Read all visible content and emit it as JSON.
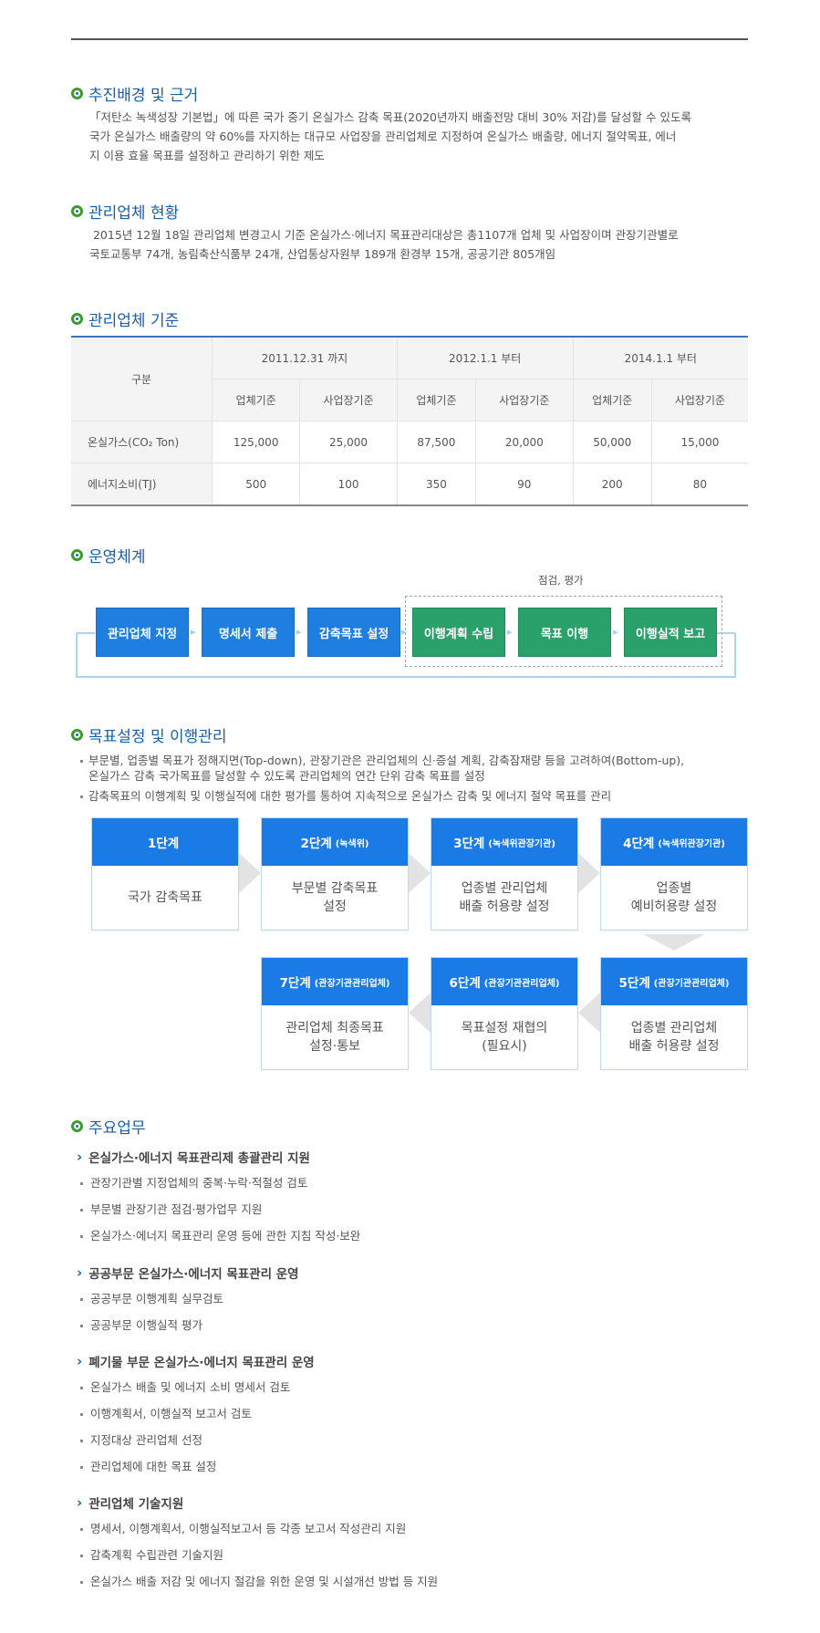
{
  "sections": {
    "background": {
      "title": "추진배경 및 근거",
      "lines": [
        "「저탄소 녹색성장 기본법」에 따른 국가 중기 온실가스 감축 목표(2020년까지 배출전망 대비 30% 저감)를 달성할 수 있도록",
        "국가 온실가스 배출량의 약 60%를 자지하는 대규모 사업장을 관리업체로 지정하여 온실가스 배출량, 에너지 절약목표, 에너",
        "지 이용 효율 목표를 설정하고 관리하기 위한 제도"
      ]
    },
    "status": {
      "title": "관리업체 현황",
      "lines": [
        " 2015년 12월 18일 관리업체 변경고시 기준 온실가스·에너지 목표관리대상은 총1107개 업체 및 사업장이며 관장기관별로",
        "국토교통부 74개, 농림축산식품부 24개, 산업통상자원부 189개 환경부 15개, 공공기관 805개임"
      ]
    },
    "criteria": {
      "title": "관리업체 기준",
      "corner": "구분",
      "periods": [
        "2011.12.31 까지",
        "2012.1.1 부터",
        "2014.1.1 부터"
      ],
      "subheads": [
        "업체기준",
        "사업장기준",
        "업체기준",
        "사업장기준",
        "업체기준",
        "사업장기준"
      ],
      "rows": [
        {
          "label": "온실가스(CO₂ Ton)",
          "values": [
            "125,000",
            "25,000",
            "87,500",
            "20,000",
            "50,000",
            "15,000"
          ]
        },
        {
          "label": "에너지소비(TJ)",
          "values": [
            "500",
            "100",
            "350",
            "90",
            "200",
            "80"
          ]
        }
      ]
    },
    "operation": {
      "title": "운영체계",
      "group_label": "점검, 평가",
      "steps": [
        "관리업체 지정",
        "명세서 제출",
        "감축목표 설정",
        "이행계획 수립",
        "목표 이행",
        "이행실적 보고"
      ]
    },
    "target": {
      "title": "목표설정 및 이행관리",
      "notes": [
        "부문별, 업종별 목표가 정해지면(Top-down), 관장기관은 관리업체의 신·증설 계획, 감축잠재량 등을 고려하여(Bottom-up),",
        "온실가스 감축 국가목표를 달성할 수 있도록 관리업체의 연간 단위 감축 목표를 설정",
        "감축목표의 이행계획 및 이행실적에 대한 평가를 통하여 지속적으로 온실가스 감축 및 에너지 절약 목표를 관리"
      ],
      "stages": [
        {
          "name": "1단계",
          "org": "",
          "body": "국가 감축목표"
        },
        {
          "name": "2단계",
          "org": "(녹색위)",
          "body": "부문별 감축목표\n설정"
        },
        {
          "name": "3단계",
          "org": "(녹색위관장기관)",
          "body": "업종별 관리업체\n배출 허용량 설정"
        },
        {
          "name": "4단계",
          "org": "(녹색위관장기관)",
          "body": "업종별\n예비허용량 설정"
        },
        {
          "name": "5단계",
          "org": "(관장기관관리업체)",
          "body": "업종별 관리업체\n배출 허용량 설정"
        },
        {
          "name": "6단계",
          "org": "(관장기관관리업체)",
          "body": "목표설정 재협의\n(필요시)"
        },
        {
          "name": "7단계",
          "org": "(관장기관관리업체)",
          "body": "관리업체 최종목표\n설정·통보"
        }
      ]
    },
    "duties": {
      "title": "주요업무",
      "groups": [
        {
          "heading": "온실가스·에너지 목표관리제 총괄관리 지원",
          "items": [
            "관장기관별 지정업체의 중복·누락·적절성 검토",
            "부문별 관장기관 점검·평가업무 지원",
            "온실가스·에너지 목표관리 운영 등에 관한 지침 작성·보완"
          ]
        },
        {
          "heading": "공공부문 온실가스·에너지 목표관리 운영",
          "items": [
            "공공부문 이행계획 실무검토",
            "공공부문 이행실적 평가"
          ]
        },
        {
          "heading": "폐기물 부문 온실가스·에너지 목표관리 운영",
          "items": [
            "온실가스 배출 및 에너지 소비 명세서 검토",
            "이행계획서, 이행실적 보고서 검토",
            "지정대상 관리업체 선정",
            "관리업체에 대한 목표 설정"
          ]
        },
        {
          "heading": "관리업체 기술지원",
          "items": [
            "명세서, 이행계획서, 이행실적보고서 등 각종 보고서 작성관리 지원",
            "감축계획 수립관련 기술지원",
            "온실가스 배출 저감 및 에너지 절감을 위한 운영 및 시설개선 방법 등 지원"
          ]
        }
      ]
    }
  },
  "colors": {
    "accent_blue": "#1a7be6",
    "accent_green": "#2aa06a",
    "title_blue": "#1a5ea8"
  }
}
